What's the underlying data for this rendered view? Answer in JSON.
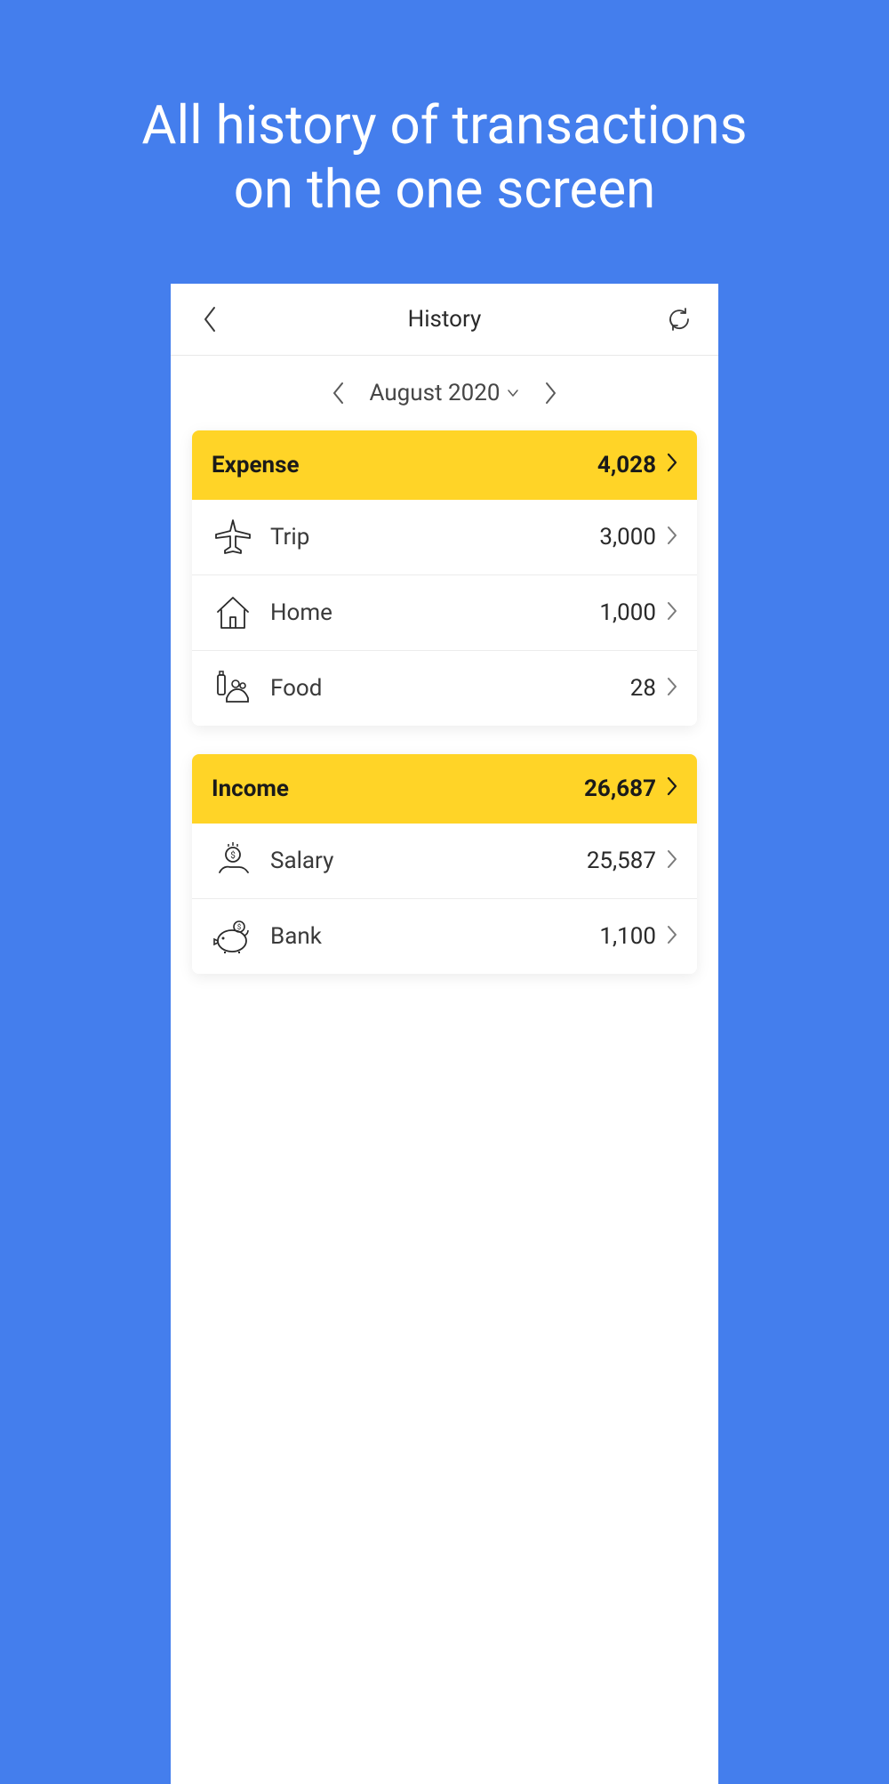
{
  "promo": {
    "headline_line1": "All history of transactions",
    "headline_line2": "on the one screen"
  },
  "nav": {
    "title": "History"
  },
  "dateSelector": {
    "label": "August 2020"
  },
  "sections": [
    {
      "title": "Expense",
      "total": "4,028",
      "items": [
        {
          "icon": "plane",
          "label": "Trip",
          "amount": "3,000"
        },
        {
          "icon": "home",
          "label": "Home",
          "amount": "1,000"
        },
        {
          "icon": "food",
          "label": "Food",
          "amount": "28"
        }
      ]
    },
    {
      "title": "Income",
      "total": "26,687",
      "items": [
        {
          "icon": "salary",
          "label": "Salary",
          "amount": "25,587"
        },
        {
          "icon": "bank",
          "label": "Bank",
          "amount": "1,100"
        }
      ]
    }
  ],
  "colors": {
    "background": "#447eed",
    "accent": "#ffd427"
  }
}
